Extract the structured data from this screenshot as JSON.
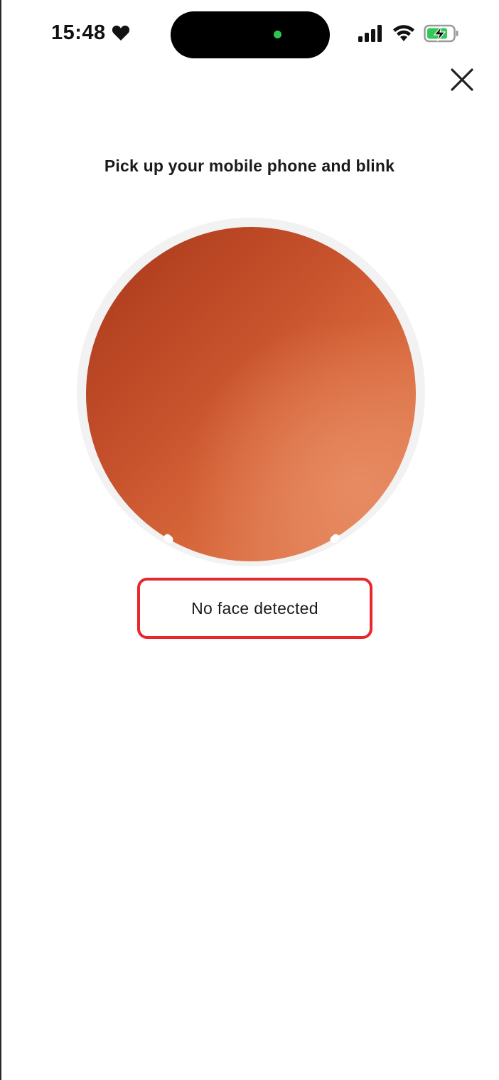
{
  "status_bar": {
    "time": "15:48",
    "icons": [
      "heart-icon",
      "signal-icon",
      "wifi-icon",
      "battery-charging-icon"
    ],
    "island_dot_color": "#2fc452"
  },
  "header": {
    "close_icon": "close-icon"
  },
  "main": {
    "instruction": "Pick up your mobile phone and blink",
    "camera_colors": [
      "#a8381b",
      "#e48a63"
    ],
    "status_message": "No face detected",
    "highlight_color": "#e8272a"
  }
}
